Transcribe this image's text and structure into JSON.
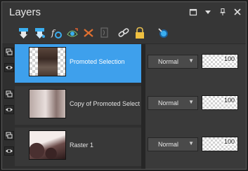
{
  "panel": {
    "title": "Layers"
  },
  "window_controls": [
    "maximize-icon",
    "dropdown-icon",
    "pin-icon",
    "close-icon"
  ],
  "toolbar": {
    "icons": [
      "new-raster-layer-icon",
      "new-vector-layer-icon",
      "new-adjustment-layer-icon",
      "mask-icon",
      "delete-layer-icon",
      "duplicate-layer-icon",
      "link-icon",
      "lock-icon",
      "properties-icon"
    ]
  },
  "layers": [
    {
      "name": "Promoted Selection",
      "blend_mode": "Normal",
      "opacity": "100",
      "selected": true
    },
    {
      "name": "Copy of Promoted Selection",
      "blend_mode": "Normal",
      "opacity": "100",
      "selected": false
    },
    {
      "name": "Raster 1",
      "blend_mode": "Normal",
      "opacity": "100",
      "selected": false
    }
  ],
  "colors": {
    "selected_row": "#3ea0ec",
    "panel_bg": "#3a3a3a",
    "accent_icon": "#3aaef0"
  }
}
